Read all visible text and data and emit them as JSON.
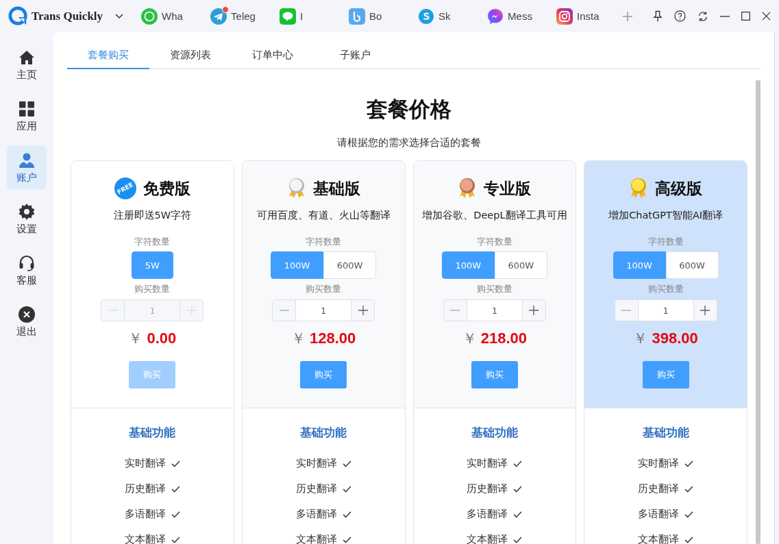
{
  "app": {
    "name": "Trans Quickly"
  },
  "app_tabs": [
    {
      "kind": "whatsapp",
      "label": "Wha",
      "badge": false
    },
    {
      "kind": "telegram",
      "label": "Teleg",
      "badge": true
    },
    {
      "kind": "line",
      "label": "I",
      "badge": false
    },
    {
      "kind": "bip",
      "label": "Bo",
      "badge": false
    },
    {
      "kind": "skype",
      "label": "Sk",
      "badge": false
    },
    {
      "kind": "messenger",
      "label": "Mess",
      "badge": false
    },
    {
      "kind": "instagram",
      "label": "Insta",
      "badge": false
    }
  ],
  "sidebar": {
    "items": [
      {
        "kind": "home",
        "label": "主页",
        "selected": false
      },
      {
        "kind": "apps",
        "label": "应用",
        "selected": false
      },
      {
        "kind": "account",
        "label": "账户",
        "selected": true
      },
      {
        "kind": "settings",
        "label": "设置",
        "selected": false
      },
      {
        "kind": "support",
        "label": "客服",
        "selected": false
      },
      {
        "kind": "logout",
        "label": "退出",
        "selected": false
      }
    ]
  },
  "tabs": [
    {
      "label": "套餐购买",
      "selected": true
    },
    {
      "label": "资源列表",
      "selected": false
    },
    {
      "label": "订单中心",
      "selected": false
    },
    {
      "label": "子账户",
      "selected": false
    }
  ],
  "heading": "套餐价格",
  "subheading": "请根据您的需求选择合适的套餐",
  "plans": [
    {
      "kind": "free",
      "badge_text": "FREE",
      "name": "免费版",
      "description": "注册即送5W字符",
      "highlighted": false,
      "chars_label": "字符数量",
      "options": [
        {
          "label": "5W",
          "selected": true
        }
      ],
      "qty_label": "购买数量",
      "quantity": "1",
      "qty_disabled": true,
      "currency": "￥",
      "price": "0.00",
      "buy": "购买",
      "buy_disabled": true,
      "features_title": "基础功能",
      "features": [
        {
          "label": "实时翻译",
          "checked": true
        },
        {
          "label": "历史翻译",
          "checked": true
        },
        {
          "label": "多语翻译",
          "checked": true
        },
        {
          "label": "文本翻译",
          "checked": true
        }
      ]
    },
    {
      "kind": "silver",
      "name": "基础版",
      "description": "可用百度、有道、火山等翻译",
      "highlighted": false,
      "chars_label": "字符数量",
      "options": [
        {
          "label": "100W",
          "selected": true
        },
        {
          "label": "600W",
          "selected": false
        }
      ],
      "qty_label": "购买数量",
      "quantity": "1",
      "qty_disabled": false,
      "currency": "￥",
      "price": "128.00",
      "buy": "购买",
      "buy_disabled": false,
      "features_title": "基础功能",
      "features": [
        {
          "label": "实时翻译",
          "checked": true
        },
        {
          "label": "历史翻译",
          "checked": true
        },
        {
          "label": "多语翻译",
          "checked": true
        },
        {
          "label": "文本翻译",
          "checked": true
        }
      ]
    },
    {
      "kind": "bronze",
      "name": "专业版",
      "description": "增加谷歌、DeepL翻译工具可用",
      "highlighted": false,
      "chars_label": "字符数量",
      "options": [
        {
          "label": "100W",
          "selected": true
        },
        {
          "label": "600W",
          "selected": false
        }
      ],
      "qty_label": "购买数量",
      "quantity": "1",
      "qty_disabled": false,
      "currency": "￥",
      "price": "218.00",
      "buy": "购买",
      "buy_disabled": false,
      "features_title": "基础功能",
      "features": [
        {
          "label": "实时翻译",
          "checked": true
        },
        {
          "label": "历史翻译",
          "checked": true
        },
        {
          "label": "多语翻译",
          "checked": true
        },
        {
          "label": "文本翻译",
          "checked": true
        }
      ]
    },
    {
      "kind": "gold",
      "name": "高级版",
      "description": "增加ChatGPT智能AI翻译",
      "highlighted": true,
      "chars_label": "字符数量",
      "options": [
        {
          "label": "100W",
          "selected": true
        },
        {
          "label": "600W",
          "selected": false
        }
      ],
      "qty_label": "购买数量",
      "quantity": "1",
      "qty_disabled": false,
      "currency": "￥",
      "price": "398.00",
      "buy": "购买",
      "buy_disabled": false,
      "features_title": "基础功能",
      "features": [
        {
          "label": "实时翻译",
          "checked": true
        },
        {
          "label": "历史翻译",
          "checked": true
        },
        {
          "label": "多语翻译",
          "checked": true
        },
        {
          "label": "文本翻译",
          "checked": true
        }
      ]
    }
  ]
}
